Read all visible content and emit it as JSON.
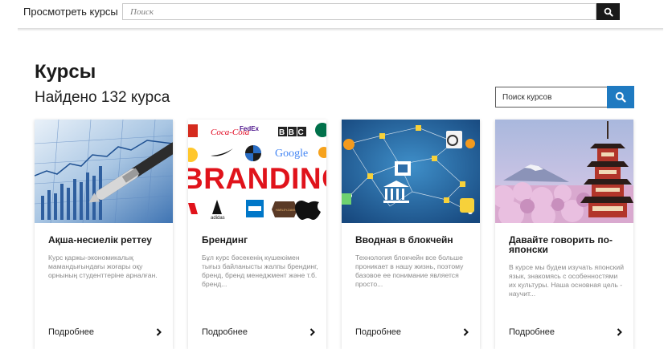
{
  "header": {
    "browse_link": "Просмотреть курсы",
    "search_placeholder": "Поиск",
    "search_icon": "search-icon"
  },
  "main": {
    "title": "Курсы",
    "results": "Найдено 132 курса",
    "course_search_placeholder": "Поиск курсов",
    "course_search_icon": "search-icon"
  },
  "courses": [
    {
      "title": "Ақша-несиелік реттеу",
      "description": "Курс қаржы-экономикалық мамандығындағы жоғары оқу орнының студенттеріне арналған.",
      "more": "Подробнее",
      "image": "finance-chart-pen"
    },
    {
      "title": "Брендинг",
      "description": "Бұл курс бәсекенің күшеюімен тығыз байланысты жалпы брендинг, бренд, бренд менеджмент және т.б. бренд...",
      "more": "Подробнее",
      "image": "branding-logos",
      "image_texts": {
        "word": "BRANDING",
        "coca": "Coca-Cola",
        "fedex": "FedEx",
        "bbc": "BBC",
        "google": "Google",
        "adidas": "adidas",
        "harley": "HARLEY-DAVIDSON"
      }
    },
    {
      "title": "Вводная в блокчейн",
      "description": "Технология блокчейн все больше проникает в нашу жизнь, поэтому базовое ее понимание является просто...",
      "more": "Подробнее",
      "image": "blockchain-network"
    },
    {
      "title": "Давайте говорить по-японски",
      "description": "В курсе мы будем изучать японский язык, знакомясь с особенностями их культуры. Наша основная цель - научит...",
      "more": "Подробнее",
      "image": "japan-pagoda-fuji"
    }
  ],
  "colors": {
    "accent": "#1f7ac1",
    "dark_button": "#1a1a1a",
    "desc_text": "#8a8a8a"
  }
}
